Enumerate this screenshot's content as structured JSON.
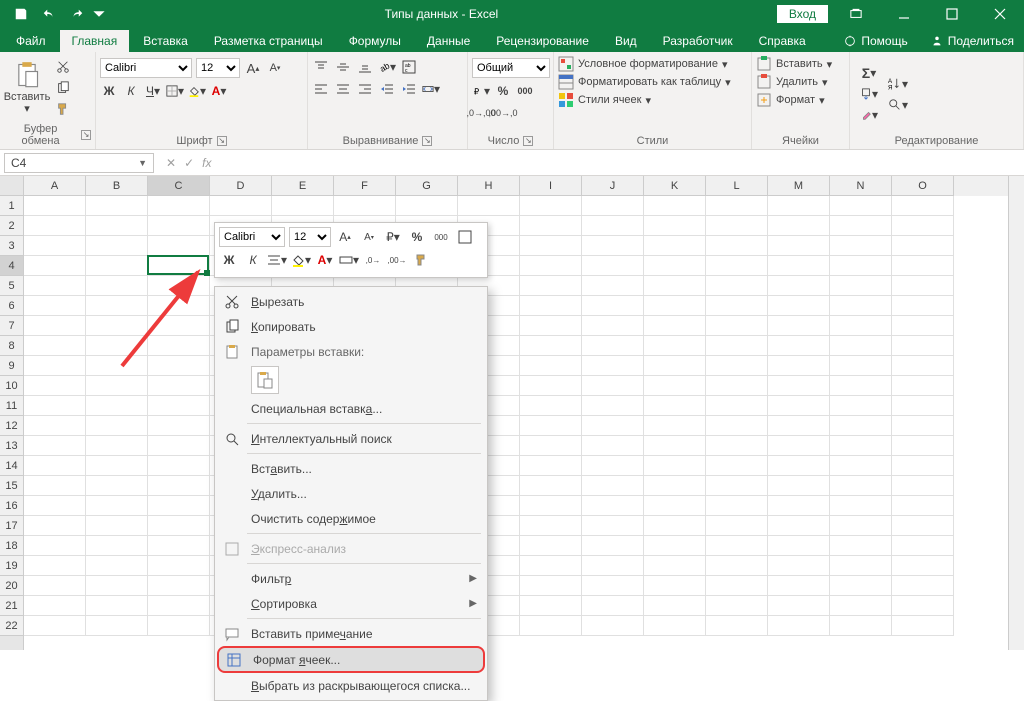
{
  "titlebar": {
    "title": "Типы данных  -  Excel",
    "login": "Вход"
  },
  "tabs": [
    "Файл",
    "Главная",
    "Вставка",
    "Разметка страницы",
    "Формулы",
    "Данные",
    "Рецензирование",
    "Вид",
    "Разработчик",
    "Справка"
  ],
  "active_tab": 1,
  "help": {
    "ask": "Помощь",
    "share": "Поделиться"
  },
  "ribbon": {
    "clipboard": {
      "label": "Буфер обмена",
      "paste": "Вставить"
    },
    "font": {
      "label": "Шрифт",
      "name": "Calibri",
      "size": "12"
    },
    "alignment": {
      "label": "Выравнивание"
    },
    "number": {
      "label": "Число",
      "format": "Общий"
    },
    "styles": {
      "label": "Стили",
      "cond": "Условное форматирование",
      "table": "Форматировать как таблицу",
      "cell": "Стили ячеек"
    },
    "cells": {
      "label": "Ячейки",
      "insert": "Вставить",
      "delete": "Удалить",
      "format": "Формат"
    },
    "editing": {
      "label": "Редактирование"
    }
  },
  "namebox": "C4",
  "columns": [
    "A",
    "B",
    "C",
    "D",
    "E",
    "F",
    "G",
    "H",
    "I",
    "J",
    "K",
    "L",
    "M",
    "N",
    "O"
  ],
  "rows": 22,
  "selected": {
    "col": 2,
    "row": 3
  },
  "minitoolbar": {
    "font": "Calibri",
    "size": "12"
  },
  "context": {
    "cut": "Вырезать",
    "copy": "Копировать",
    "pasteopts": "Параметры вставки:",
    "pastespecial": "Специальная вставка...",
    "smartlookup": "Интеллектуальный поиск",
    "insert": "Вставить...",
    "delete": "Удалить...",
    "clear": "Очистить содержимое",
    "quick": "Экспресс-анализ",
    "filter": "Фильтр",
    "sort": "Сортировка",
    "comment": "Вставить примечание",
    "format": "Формат ячеек...",
    "dropdown": "Выбрать из раскрывающегося списка..."
  }
}
